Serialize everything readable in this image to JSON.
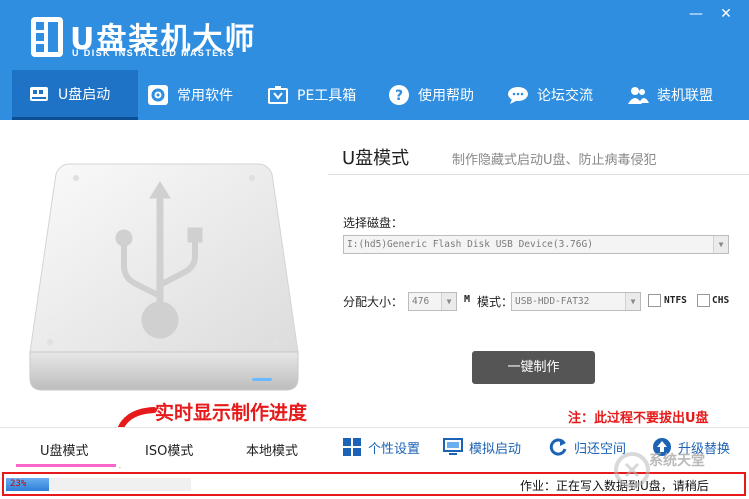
{
  "app": {
    "title": "U盘装机大师",
    "subtitle": "U DISK INSTALLED MASTERS"
  },
  "window": {
    "minimize_glyph": "—",
    "close_glyph": "✕"
  },
  "nav": [
    {
      "label": "U盘启动",
      "icon": "usb-drive-icon",
      "active": true
    },
    {
      "label": "常用软件",
      "icon": "software-icon"
    },
    {
      "label": "PE工具箱",
      "icon": "toolbox-icon"
    },
    {
      "label": "使用帮助",
      "icon": "help-icon"
    },
    {
      "label": "论坛交流",
      "icon": "chat-icon"
    },
    {
      "label": "装机联盟",
      "icon": "users-icon"
    }
  ],
  "mode": {
    "title": "U盘模式",
    "description": "制作隐藏式启动U盘、防止病毒侵犯"
  },
  "form": {
    "disk_label": "选择磁盘：",
    "disk_value": "I:(hd5)Generic Flash Disk USB Device(3.76G)",
    "alloc_label": "分配大小：",
    "alloc_value": "476",
    "m_label": "M",
    "mode_label": "模式：",
    "mode_value": "USB-HDD-FAT32",
    "ntfs_label": "NTFS",
    "chs_label": "CHS",
    "ntfs_checked": false,
    "chs_checked": false
  },
  "make_button": "一键制作",
  "annotations": {
    "realtime": "实时显示制作进度",
    "note": "注：此过程不要拔出U盘"
  },
  "tabs": [
    "U盘模式",
    "ISO模式",
    "本地模式"
  ],
  "tools": [
    {
      "label": "个性设置",
      "icon": "grid-settings-icon"
    },
    {
      "label": "模拟启动",
      "icon": "monitor-icon"
    },
    {
      "label": "归还空间",
      "icon": "refresh-icon"
    },
    {
      "label": "升级替换",
      "icon": "upgrade-icon"
    }
  ],
  "status": {
    "progress_percent": 23,
    "progress_text": "23%",
    "status_text": "作业：正在写入数据到U盘，请稍后"
  },
  "watermark": "系统天堂",
  "colors": {
    "brand_blue": "#2f8ee0",
    "nav_active": "#1f73c6",
    "annotation_red": "#e61a1a",
    "link_blue": "#1d63b5",
    "tab_underline": "#ff66cc"
  }
}
